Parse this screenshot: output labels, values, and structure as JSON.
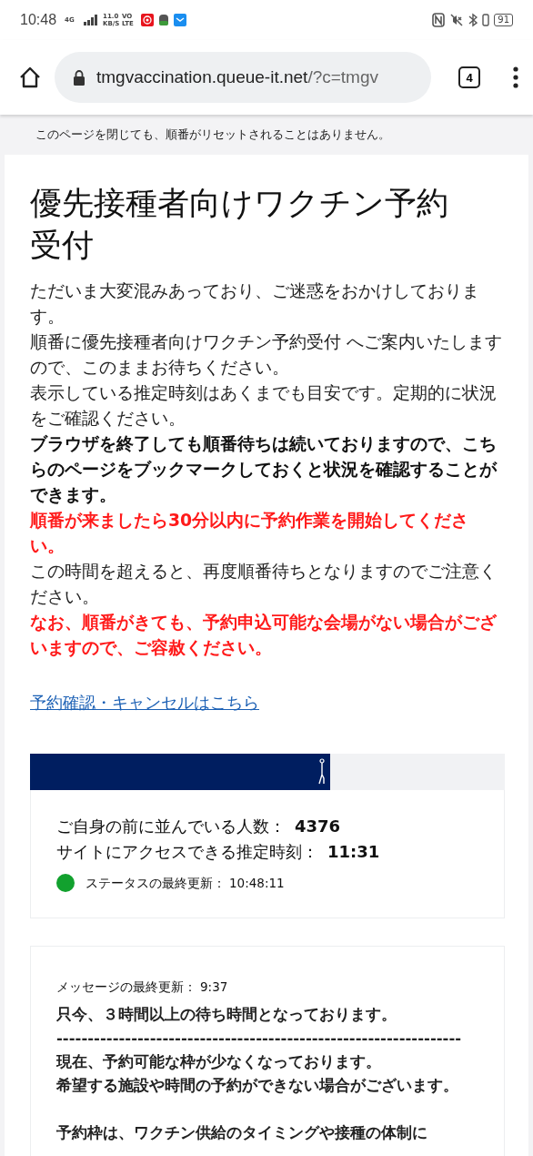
{
  "status_bar": {
    "time": "10:48",
    "network": "4G",
    "speed": "11.0 KB/S",
    "volte": "VO LTE",
    "battery": "91"
  },
  "browser": {
    "url_host": "tmgvaccination.queue-it.net",
    "url_rest": "/?c=tmgv",
    "tab_count": "4"
  },
  "notice": "このページを閉じても、順番がリセットされることはありません。",
  "title": "優先接種者向けワクチン予約受付",
  "paragraphs": [
    {
      "kind": "plain",
      "text": "ただいま大変混みあっており、ご迷惑をおかけしております。"
    },
    {
      "kind": "plain",
      "text": "順番に優先接種者向けワクチン予約受付 へご案内いたしますので、このままお待ちください。"
    },
    {
      "kind": "plain",
      "text": "表示している推定時刻はあくまでも目安です。定期的に状況をご確認ください。"
    },
    {
      "kind": "bold",
      "text": "ブラウザを終了しても順番待ちは続いておりますので、こちらのページをブックマークしておくと状況を確認することができます。"
    },
    {
      "kind": "alert",
      "text": "順番が来ましたら30分以内に予約作業を開始してください。"
    },
    {
      "kind": "plain",
      "text": "この時間を超えると、再度順番待ちとなりますのでご注意ください。"
    },
    {
      "kind": "alert",
      "text": "なお、順番がきても、予約申込可能な会場がない場合がございますので、ご容赦ください。"
    }
  ],
  "link": "予約確認・キャンセルはこちら",
  "queue": {
    "level": 0.632,
    "ahead_label": "ご自身の前に並んでいる人数：",
    "ahead_value": "4376",
    "eta_label": "サイトにアクセスできる推定時刻：",
    "eta_value": "11:31",
    "updated_label": "ステータスの最終更新：",
    "updated_value": "10:48:11"
  },
  "message": {
    "updated_label": "メッセージの最終更新：",
    "updated_value": "9:37",
    "lines": [
      {
        "kind": "text",
        "text": "只今、３時間以上の待ち時間となっております。"
      },
      {
        "kind": "text",
        "text": "-----------------------------------------------------------------"
      },
      {
        "kind": "text",
        "text": "現在、予約可能な枠が少なくなっております。"
      },
      {
        "kind": "text",
        "text": "希望する施設や時間の予約ができない場合がございます。"
      },
      {
        "kind": "gap"
      },
      {
        "kind": "text",
        "text": "予約枠は、ワクチン供給のタイミングや接種の体制に"
      }
    ]
  }
}
